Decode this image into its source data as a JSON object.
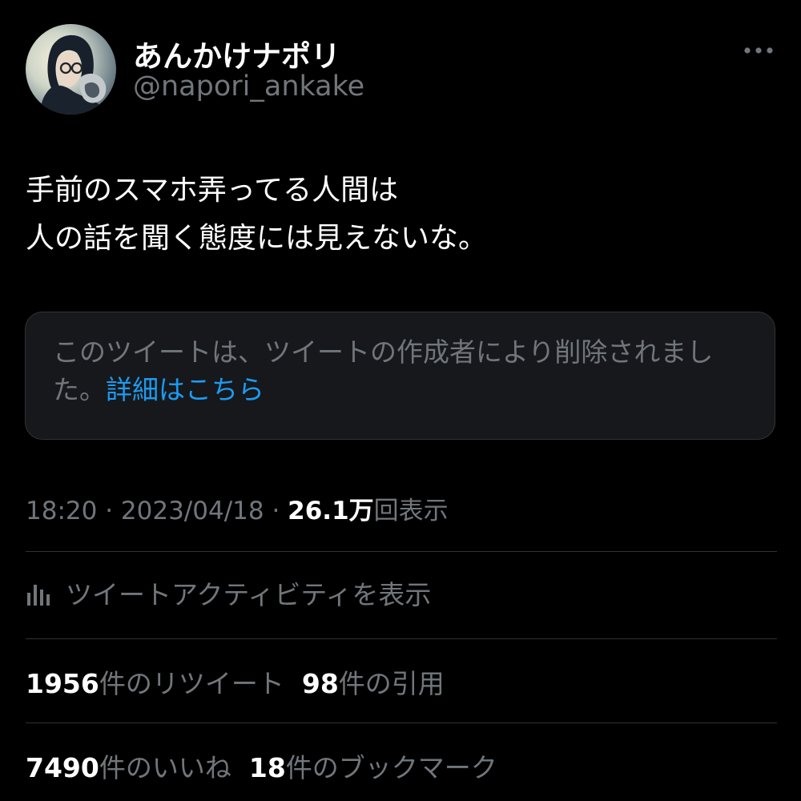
{
  "author": {
    "display_name": "あんかけナポリ",
    "handle": "@napori_ankake"
  },
  "tweet": {
    "lines": [
      "手前のスマホ弄ってる人間は",
      "人の話を聞く態度には見えないな。"
    ]
  },
  "quoted_card": {
    "message": "このツイートは、ツイートの作成者により削除されました。",
    "link_text": "詳細はこちら"
  },
  "meta": {
    "time": "18:20",
    "separator": " · ",
    "date": "2023/04/18",
    "views_count": "26.1万",
    "views_label": "回表示"
  },
  "activity": {
    "label": "ツイートアクティビティを表示"
  },
  "stats": {
    "retweets": {
      "count": "1956",
      "label": "件のリツイート"
    },
    "quotes": {
      "count": "98",
      "label": "件の引用"
    },
    "likes": {
      "count": "7490",
      "label": "件のいいね"
    },
    "bookmarks": {
      "count": "18",
      "label": "件のブックマーク"
    }
  },
  "icons": {
    "more": "more-horizontal-icon",
    "activity": "bar-chart-icon"
  },
  "colors": {
    "background": "#000000",
    "text_primary": "#ffffff",
    "text_secondary": "#71767b",
    "link": "#1d9bf0",
    "card_background": "#16181c",
    "border": "#2f3336"
  }
}
